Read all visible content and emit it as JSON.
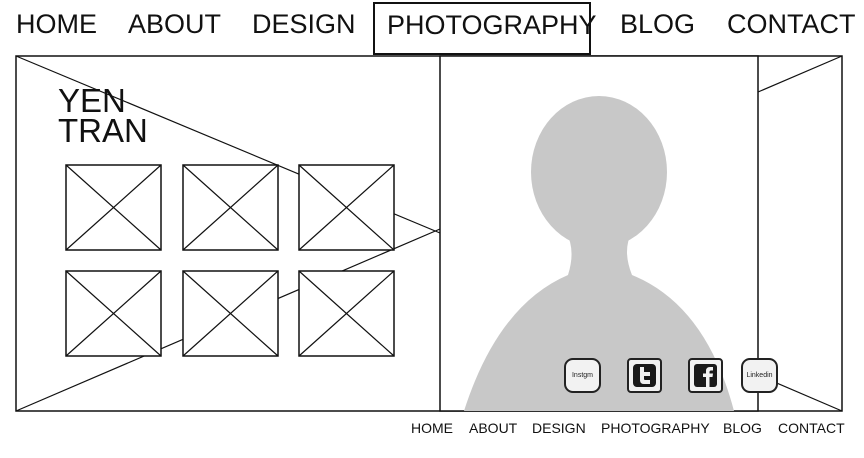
{
  "nav": {
    "items": [
      "HOME",
      "ABOUT",
      "DESIGN",
      "PHOTOGRAPHY",
      "BLOG",
      "CONTACT"
    ],
    "active": "PHOTOGRAPHY"
  },
  "hero": {
    "name_line1": "YEN",
    "name_line2": "TRAN"
  },
  "gallery": {
    "thumbnail_count": 6
  },
  "social": {
    "instagram_label": "Instgm",
    "twitter_icon": "twitter-icon",
    "facebook_icon": "facebook-icon",
    "linkedin_label": "Linkedin"
  },
  "footer": {
    "items": [
      "HOME",
      "ABOUT",
      "DESIGN",
      "PHOTOGRAPHY",
      "BLOG",
      "CONTACT"
    ]
  },
  "colors": {
    "stroke": "#111111",
    "silhouette": "#c8c8c8",
    "background": "#ffffff"
  }
}
